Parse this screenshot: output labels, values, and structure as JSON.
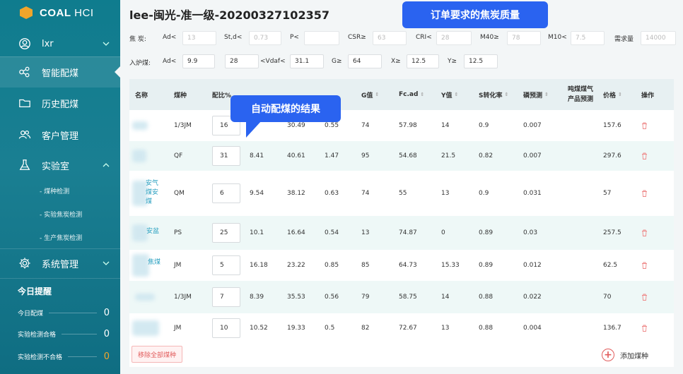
{
  "brand": {
    "bold": "COAL",
    "light": " HCI",
    "accent": "#f0a52b"
  },
  "sidebar": {
    "user": "lxr",
    "items": [
      {
        "label": "智能配煤",
        "icon": "molecule-icon"
      },
      {
        "label": "历史配煤",
        "icon": "folder-icon"
      },
      {
        "label": "客户管理",
        "icon": "users-icon"
      },
      {
        "label": "实验室",
        "icon": "flask-icon"
      },
      {
        "label": "系统管理",
        "icon": "gear-icon"
      }
    ],
    "lab_sub": [
      "- 煤种检测",
      "- 实验焦炭检测",
      "- 生产焦炭检测"
    ],
    "reminder": {
      "title": "今日提醒",
      "rows": [
        {
          "label": "今日配煤",
          "value": "0"
        },
        {
          "label": "实验检测合格",
          "value": "0"
        },
        {
          "label": "实验检测不合格",
          "value": "0"
        }
      ]
    }
  },
  "page_title": "lee-闽光-准一级-20200327102357",
  "callouts": {
    "order": "订单要求的焦炭质量",
    "auto": "自动配煤的结果"
  },
  "coke_quality": {
    "label": "焦  炭:",
    "fields": [
      {
        "name": "Ad<",
        "value": "13"
      },
      {
        "name": "St,d<",
        "value": "0.73"
      },
      {
        "name": "P<",
        "value": ""
      },
      {
        "name": "CSR≥",
        "value": "63"
      },
      {
        "name": "CRI<",
        "value": "28"
      },
      {
        "name": "M40≥",
        "value": "78"
      },
      {
        "name": "M10<",
        "value": "7.5"
      },
      {
        "name": "需求量",
        "value": "14000"
      }
    ]
  },
  "furnace_coal": {
    "label": "入炉煤:",
    "fields": [
      {
        "name": "Ad<",
        "value": "9.9"
      },
      {
        "name": "",
        "value": "28"
      },
      {
        "name": "<Vdaf<",
        "value": "31.1"
      },
      {
        "name": "G≥",
        "value": "64"
      },
      {
        "name": "X≥",
        "value": "12.5"
      },
      {
        "name": "Y≥",
        "value": "12.5"
      }
    ]
  },
  "table": {
    "headers": [
      "名称",
      "煤种",
      "配比%",
      "",
      "",
      "",
      "G值",
      "Fc.ad",
      "Y值",
      "S转化率",
      "磷预测",
      "吨煤煤气产品预测",
      "价格",
      "操作"
    ],
    "rows": [
      {
        "name_frag": "",
        "type": "1/3JM",
        "ratio": "16",
        "c1": "30.49",
        "c2": "0.55",
        "g": "74",
        "fc": "57.98",
        "y": "14",
        "s": "0.9",
        "p": "0.007",
        "price": "157.6"
      },
      {
        "name_frag": "",
        "type": "QF",
        "ratio": "31",
        "c0": "8.41",
        "c1": "40.61",
        "c2": "1.47",
        "g": "95",
        "fc": "54.68",
        "y": "21.5",
        "s": "0.82",
        "p": "0.007",
        "price": "297.6"
      },
      {
        "name_frag": "安气\n煤安\n煤",
        "type": "QM",
        "ratio": "6",
        "c0": "9.54",
        "c1": "38.12",
        "c2": "0.63",
        "g": "74",
        "fc": "55",
        "y": "13",
        "s": "0.9",
        "p": "0.031",
        "price": "57"
      },
      {
        "name_frag": "安盆",
        "type": "PS",
        "ratio": "25",
        "c0": "10.1",
        "c1": "16.64",
        "c2": "0.54",
        "g": "13",
        "fc": "74.87",
        "y": "0",
        "s": "0.89",
        "p": "0.03",
        "price": "257.5"
      },
      {
        "name_frag": "焦煤",
        "type": "JM",
        "ratio": "5",
        "c0": "16.18",
        "c1": "23.22",
        "c2": "0.85",
        "g": "85",
        "fc": "64.73",
        "y": "15.33",
        "s": "0.89",
        "p": "0.012",
        "price": "62.5"
      },
      {
        "name_frag": "",
        "type": "1/3JM",
        "ratio": "7",
        "c0": "8.39",
        "c1": "35.53",
        "c2": "0.56",
        "g": "79",
        "fc": "58.75",
        "y": "14",
        "s": "0.88",
        "p": "0.022",
        "price": "70"
      },
      {
        "name_frag": "",
        "type": "JM",
        "ratio": "10",
        "c0": "10.52",
        "c1": "19.33",
        "c2": "0.5",
        "g": "82",
        "fc": "72.67",
        "y": "13",
        "s": "0.88",
        "p": "0.004",
        "price": "136.7"
      }
    ],
    "remove_all": "移除全部煤种",
    "add_coal": "添加煤种"
  }
}
